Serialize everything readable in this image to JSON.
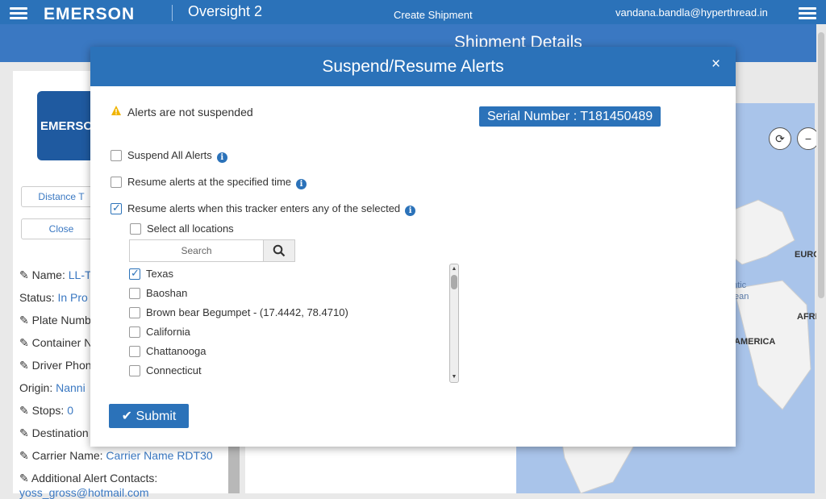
{
  "header": {
    "brand": "EMERSON",
    "app_name": "Oversight 2",
    "create_shipment": "Create Shipment",
    "user_email": "vandana.bandla@hyperthread.in",
    "page_heading": "Shipment Details"
  },
  "left_panel": {
    "logo_text": "EMERSO",
    "distance_button": "Distance T",
    "close_button": "Close",
    "name_label": "Name:",
    "name_value": "LL-T",
    "status_label": "Status:",
    "status_value": "In Pro",
    "plate_label": "Plate Numb",
    "container_label": "Container N",
    "driver_label": "Driver Phon",
    "origin_label": "Origin:",
    "origin_value": "Nanni",
    "stops_label": "Stops:",
    "stops_value": "0",
    "destination_label": "Destination",
    "carrier_label": "Carrier Name:",
    "carrier_value": "Carrier Name RDT30",
    "contacts_label": "Additional Alert Contacts:",
    "contacts_value": "yoss_gross@hotmail.com"
  },
  "map": {
    "labels": [
      "EURC",
      "ntic",
      "ean",
      "AFRI",
      "AMERICA"
    ]
  },
  "modal": {
    "title": "Suspend/Resume Alerts",
    "close_symbol": "×",
    "status_text": "Alerts are not suspended",
    "serial_number": "Serial Number : T181450489",
    "options": [
      {
        "label": "Suspend All Alerts",
        "checked": false
      },
      {
        "label": "Resume alerts at the specified time",
        "checked": false
      },
      {
        "label": "Resume alerts when this tracker enters any of the selected",
        "checked": true
      }
    ],
    "select_all_label": "Select all locations",
    "search_placeholder": "Search",
    "locations": [
      {
        "name": "Texas",
        "checked": true
      },
      {
        "name": "Baoshan",
        "checked": false
      },
      {
        "name": "Brown bear Begumpet - (17.4442, 78.4710)",
        "checked": false
      },
      {
        "name": "California",
        "checked": false
      },
      {
        "name": "Chattanooga",
        "checked": false
      },
      {
        "name": "Connecticut",
        "checked": false
      }
    ],
    "submit_label": "Submit"
  },
  "colors": {
    "primary": "#2b72b9",
    "warning": "#f0b400"
  }
}
